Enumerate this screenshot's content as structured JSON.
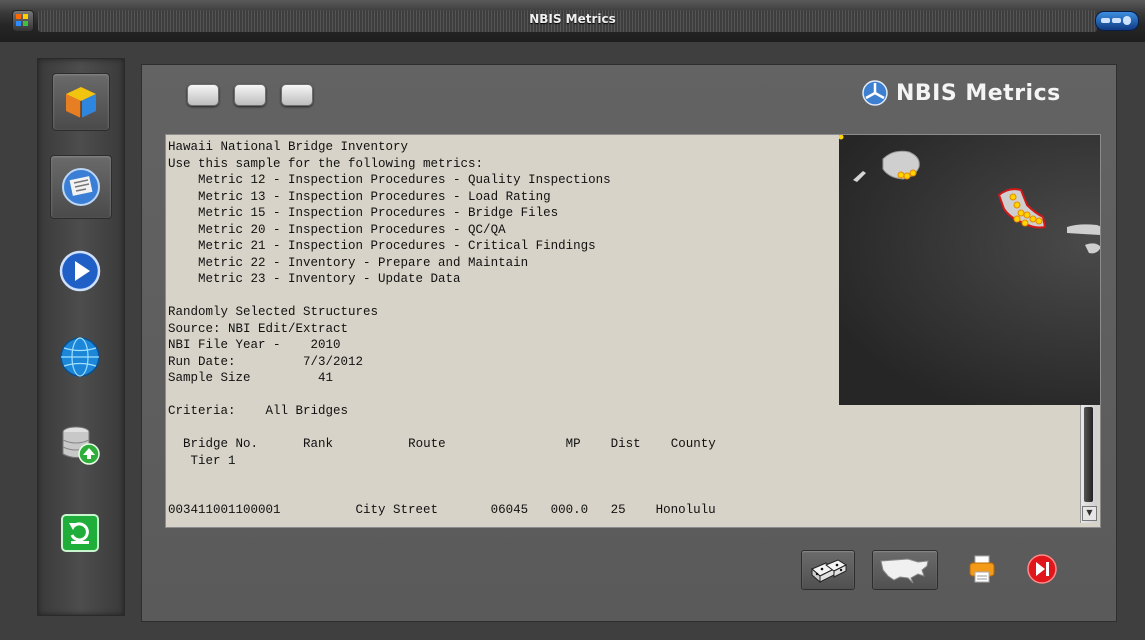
{
  "window": {
    "title": "NBIS Metrics"
  },
  "logo": {
    "text": "NBIS Metrics"
  },
  "sidebar": {
    "items": [
      {
        "icon": "cube-icon"
      },
      {
        "icon": "checklist-icon"
      },
      {
        "icon": "play-icon"
      },
      {
        "icon": "globe-icon"
      },
      {
        "icon": "database-icon"
      },
      {
        "icon": "refresh-icon"
      }
    ]
  },
  "report": {
    "title": "Hawaii National Bridge Inventory",
    "intro": "Use this sample for the following metrics:",
    "metrics": [
      "Metric 12 - Inspection Procedures - Quality Inspections",
      "Metric 13 - Inspection Procedures - Load Rating",
      "Metric 15 - Inspection Procedures - Bridge Files",
      "Metric 20 - Inspection Procedures - QC/QA",
      "Metric 21 - Inspection Procedures - Critical Findings",
      "Metric 22 - Inventory - Prepare and Maintain",
      "Metric 23 - Inventory - Update Data"
    ],
    "section_title": "Randomly Selected Structures",
    "source_label": "Source:",
    "source": "NBI Edit/Extract",
    "file_year_label": "NBI File Year -",
    "file_year": "2010",
    "run_date_label": "Run Date:",
    "run_date": "7/3/2012",
    "sample_size_label": "Sample Size",
    "sample_size": "41",
    "criteria_label": "Criteria:",
    "criteria": "All Bridges",
    "columns": [
      "Bridge No.",
      "Rank",
      "Route",
      "MP",
      "Dist",
      "County"
    ],
    "tier": "Tier 1",
    "rows": [
      {
        "bridge_no": "003411001100001",
        "rank": "",
        "route": "City Street",
        "route_no": "06045",
        "mp": "000.0",
        "dist": "25",
        "county": "Honolulu"
      }
    ]
  },
  "toolbar": {
    "dice_icon": "dice-icon",
    "map_icon": "usa-map-icon",
    "print_icon": "printer-icon",
    "exit_icon": "exit-icon"
  },
  "colors": {
    "accent_red": "#e0161b",
    "accent_orange": "#f39a19",
    "paper": "#d7d3c8",
    "map_dot": "#ffd400"
  }
}
